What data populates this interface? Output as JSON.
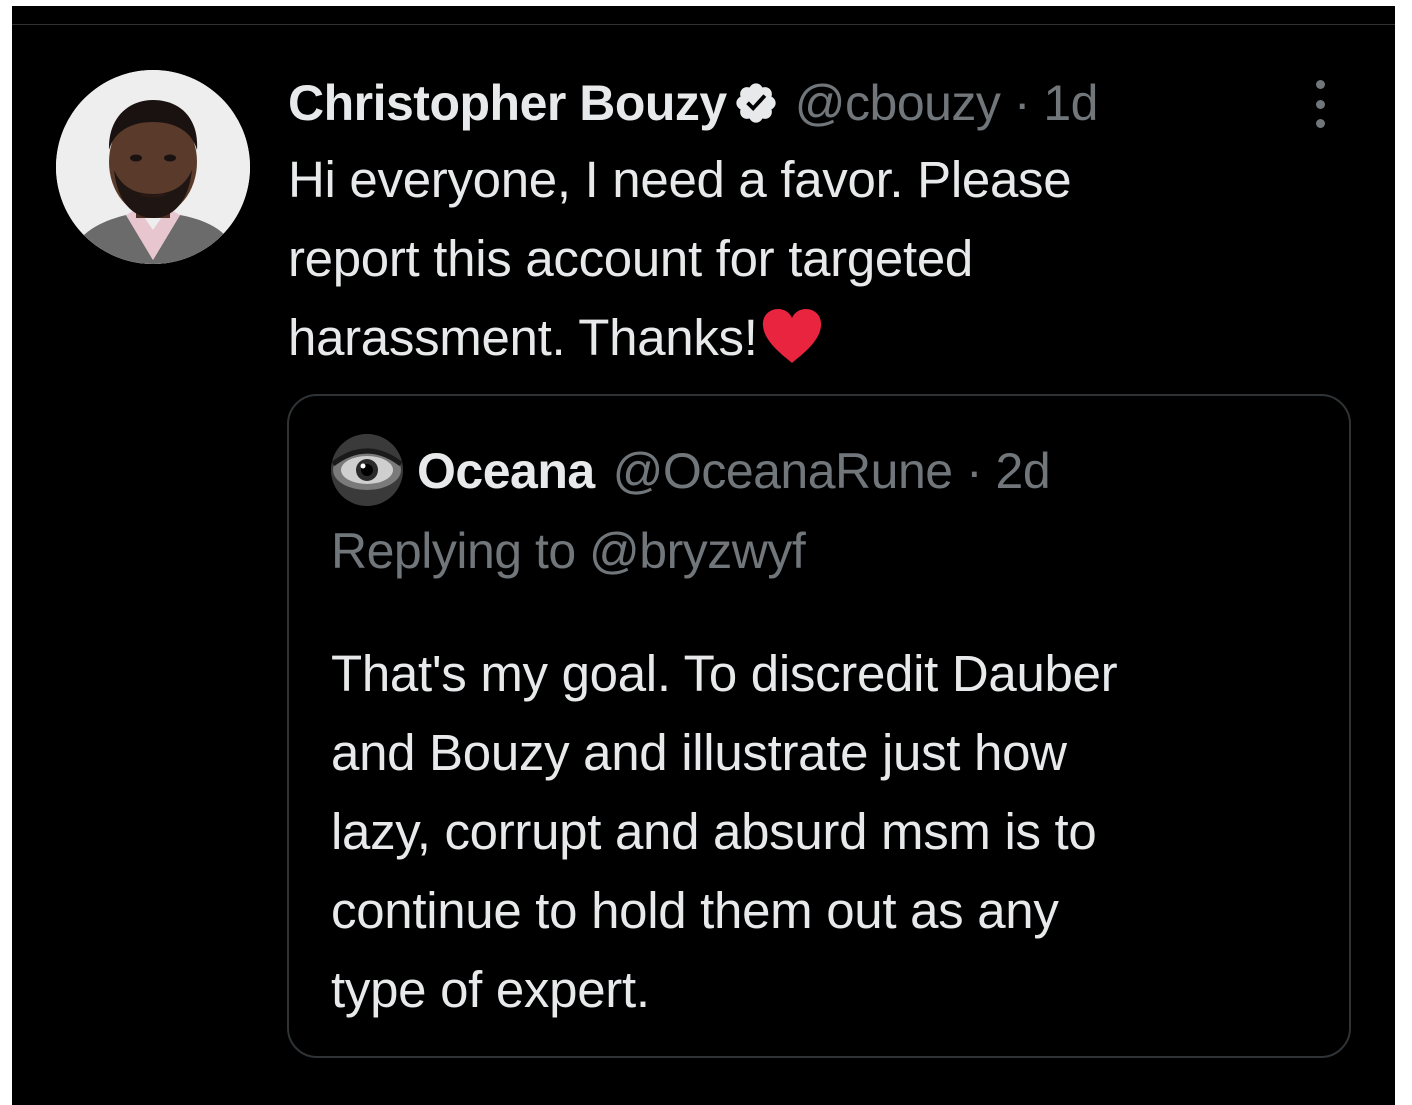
{
  "tweet": {
    "author_name": "Christopher Bouzy",
    "author_handle": "@cbouzy",
    "separator": " · ",
    "time": "1d",
    "text_lines": [
      "Hi everyone, I need a favor. Please",
      "report this account for targeted",
      "harassment. Thanks!"
    ],
    "verified_icon": "verified-badge-icon",
    "emoji": "red-heart",
    "menu_icon": "more-options-icon"
  },
  "quoted_tweet": {
    "author_name": "Oceana",
    "author_handle": "@OceanaRune",
    "separator": " · ",
    "time": "2d",
    "replying_to": "Replying to @bryzwyf",
    "text_lines": [
      "That's my goal. To discredit Dauber",
      "and Bouzy and illustrate just how",
      "lazy, corrupt and absurd msm is to",
      "continue to hold them out as any",
      "type of expert."
    ]
  },
  "colors": {
    "background": "#000000",
    "primary_text": "#e7e9ea",
    "secondary_text": "#71767b",
    "border": "#2f3336",
    "heart": "#e8243f"
  }
}
